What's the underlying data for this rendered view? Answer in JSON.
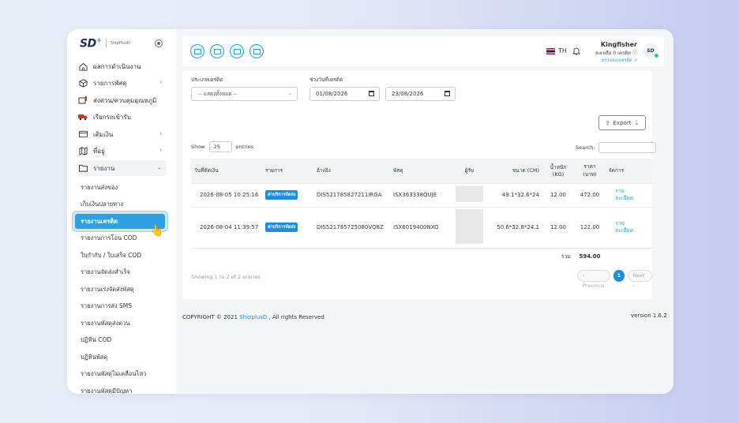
{
  "brand": {
    "logo_mark": "SD",
    "logo_plus": "+",
    "logo_text": "ShipPlusD"
  },
  "sidebar": {
    "items": [
      {
        "label": "ผลการดำเนินงาน",
        "icon": "home-icon"
      },
      {
        "label": "รายการพัสดุ",
        "icon": "box-icon"
      },
      {
        "label": "ส่งด่วน/ควบคุมอุณหภูมิ",
        "icon": "thermo-box-icon"
      },
      {
        "label": "เรียกรถเข้ารับ",
        "icon": "truck-icon"
      },
      {
        "label": "เติมเงิน",
        "icon": "wallet-icon"
      },
      {
        "label": "ที่อยู่",
        "icon": "map-icon"
      },
      {
        "label": "รายงาน",
        "icon": "folder-icon"
      }
    ],
    "report_sub": [
      "รายงานส่งของ",
      "เก็บเงินปลายทาง",
      "รายงานเครดิต",
      "รายงานการโอน COD",
      "ใบกำกับ / ใบเสร็จ COD",
      "รายงานจัดส่งสำเร็จ",
      "รายงานเร่งจัดส่งพัสดุ",
      "รายงานการส่ง SMS",
      "รายงานพัสดุส่งด่วน",
      "ปฏิทิน COD",
      "ปฏิทินพัสดุ",
      "รายงานพัสดุไม่เคลื่อนไหว",
      "รายงานพัสดุมีปัญหา"
    ]
  },
  "topbar": {
    "lang": "TH",
    "user_name": "Kingfisher",
    "credit_text": "คงเหลือ 0 เครดิต",
    "credit_link": "ตรวจสอบเครดิต",
    "avatar_text": "SD"
  },
  "filters": {
    "type_label": "ประเภทเครดิต",
    "type_value": "-- แสดงทั้งหมด --",
    "range_label": "ช่วงวันที่เครดิต",
    "date_from": "01/08/2026",
    "date_to": "23/08/2026",
    "export_label": "Export"
  },
  "table_controls": {
    "show_label": "Show",
    "show_value": "25",
    "entries_label": "entries",
    "search_label": "Search:"
  },
  "table": {
    "headers": [
      "วันที่ตัดเงิน",
      "รายการ",
      "อ้างอิง",
      "พัสดุ",
      "ผู้รับ",
      "ขนาด (CM)",
      "น้ำหนัก (KG)",
      "ราคา (บาท)",
      "จัดการ"
    ],
    "rows": [
      {
        "date": "2026-08-05 10:25:16",
        "type": "ค่าบริการจัดส่ง",
        "ref": "DIS521785827211IRGA",
        "parcel": "ISX363338QUJE",
        "size": "49.1*32.6*24",
        "weight": "12.00",
        "price": "472.00",
        "action": "ราย ละเอียด"
      },
      {
        "date": "2026-08-04 11:39:57",
        "type": "ค่าบริการจัดส่ง",
        "ref": "DIS521785725080VQ8Z",
        "parcel": "ISX6019400NXO",
        "size": "50.6*32.8*24.1",
        "weight": "12.00",
        "price": "122.00",
        "action": "ราย ละเอียด"
      }
    ],
    "total_label": "รวม",
    "total_value": "594.00"
  },
  "pagination": {
    "showing": "Showing 1 to 2 of 2 entries",
    "prev": "Previous",
    "current": "1",
    "next": "Next"
  },
  "footer": {
    "copyright_prefix": "COPYRIGHT © 2021",
    "brand_link": "ShipplusD",
    "copyright_suffix": ", All rights Reserved",
    "version": "version 1.6.2"
  },
  "colors": {
    "accent": "#2ea0e2",
    "brand_dark": "#1e3151",
    "link": "#2aa4c8",
    "badge": "#1f8ed8"
  }
}
